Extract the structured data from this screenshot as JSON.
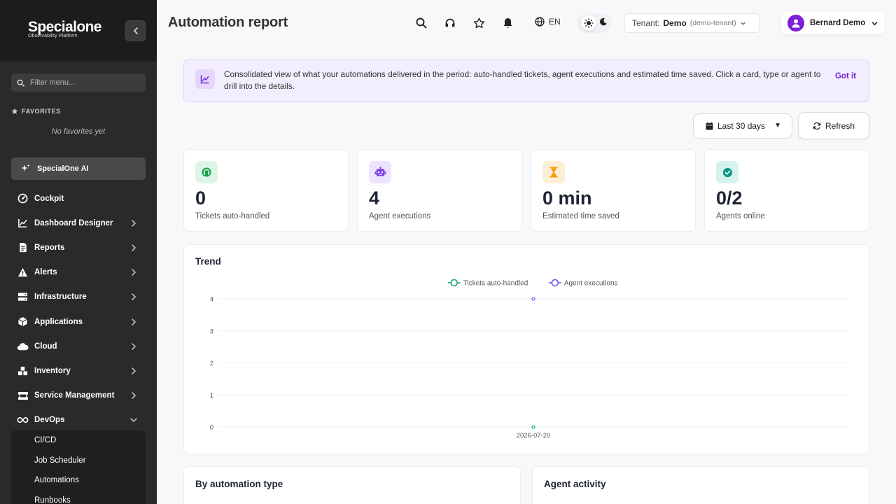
{
  "sidebar": {
    "brand": "Specialone",
    "brand_sub": "Observability Platform",
    "filter_placeholder": "Filter menu...",
    "favorites_heading": "FAVORITES",
    "favorites_empty": "No favorites yet",
    "ai_button": "SpecialOne AI",
    "items": [
      {
        "label": "Cockpit",
        "icon": "gauge-icon"
      },
      {
        "label": "Dashboard Designer",
        "icon": "chart-line-icon"
      },
      {
        "label": "Reports",
        "icon": "document-icon"
      },
      {
        "label": "Alerts",
        "icon": "warning-icon"
      },
      {
        "label": "Infrastructure",
        "icon": "server-icon"
      },
      {
        "label": "Applications",
        "icon": "cube-icon"
      },
      {
        "label": "Cloud",
        "icon": "cloud-icon"
      },
      {
        "label": "Inventory",
        "icon": "boxes-icon"
      },
      {
        "label": "Service Management",
        "icon": "ticket-icon"
      },
      {
        "label": "DevOps",
        "icon": "infinity-icon"
      }
    ],
    "devops_subitems": [
      "CI/CD",
      "Job Scheduler",
      "Automations",
      "Runbooks"
    ]
  },
  "header": {
    "title": "Automation report",
    "language": "EN",
    "tenant_label": "Tenant:",
    "tenant_name": "Demo",
    "tenant_id": "(demo-tenant)",
    "user_name": "Bernard Demo"
  },
  "info_banner": {
    "text": "Consolidated view of what your automations delivered in the period: auto-handled tickets, agent executions and estimated time saved. Click a card, type or agent to drill into the details.",
    "dismiss": "Got it"
  },
  "toolbar": {
    "range": "Last 30 days",
    "refresh": "Refresh"
  },
  "kpis": [
    {
      "value": "0",
      "label": "Tickets auto-handled",
      "icon": "headset-icon",
      "color": "#16a34a",
      "bg": "#dcf5e6"
    },
    {
      "value": "4",
      "label": "Agent executions",
      "icon": "robot-icon",
      "color": "#7c3aed",
      "bg": "#ece3fd"
    },
    {
      "value": "0 min",
      "label": "Estimated time saved",
      "icon": "hourglass-icon",
      "color": "#f59e0b",
      "bg": "#fdefd6"
    },
    {
      "value": "0/2",
      "label": "Agents online",
      "icon": "check-circle-icon",
      "color": "#0d9488",
      "bg": "#d6f1ee"
    }
  ],
  "trend": {
    "title": "Trend"
  },
  "chart_data": {
    "type": "line",
    "title": "Trend",
    "x": [
      "2026-07-20"
    ],
    "series": [
      {
        "name": "Tickets auto-handled",
        "values": [
          0
        ],
        "color": "#16a37a"
      },
      {
        "name": "Agent executions",
        "values": [
          4
        ],
        "color": "#6e5ce6"
      }
    ],
    "ylim": [
      0,
      4
    ],
    "yticks": [
      0,
      1,
      2,
      3,
      4
    ],
    "grid": true,
    "legend": "top-center"
  },
  "panels": {
    "by_type": "By automation type",
    "agent_activity": "Agent activity"
  }
}
